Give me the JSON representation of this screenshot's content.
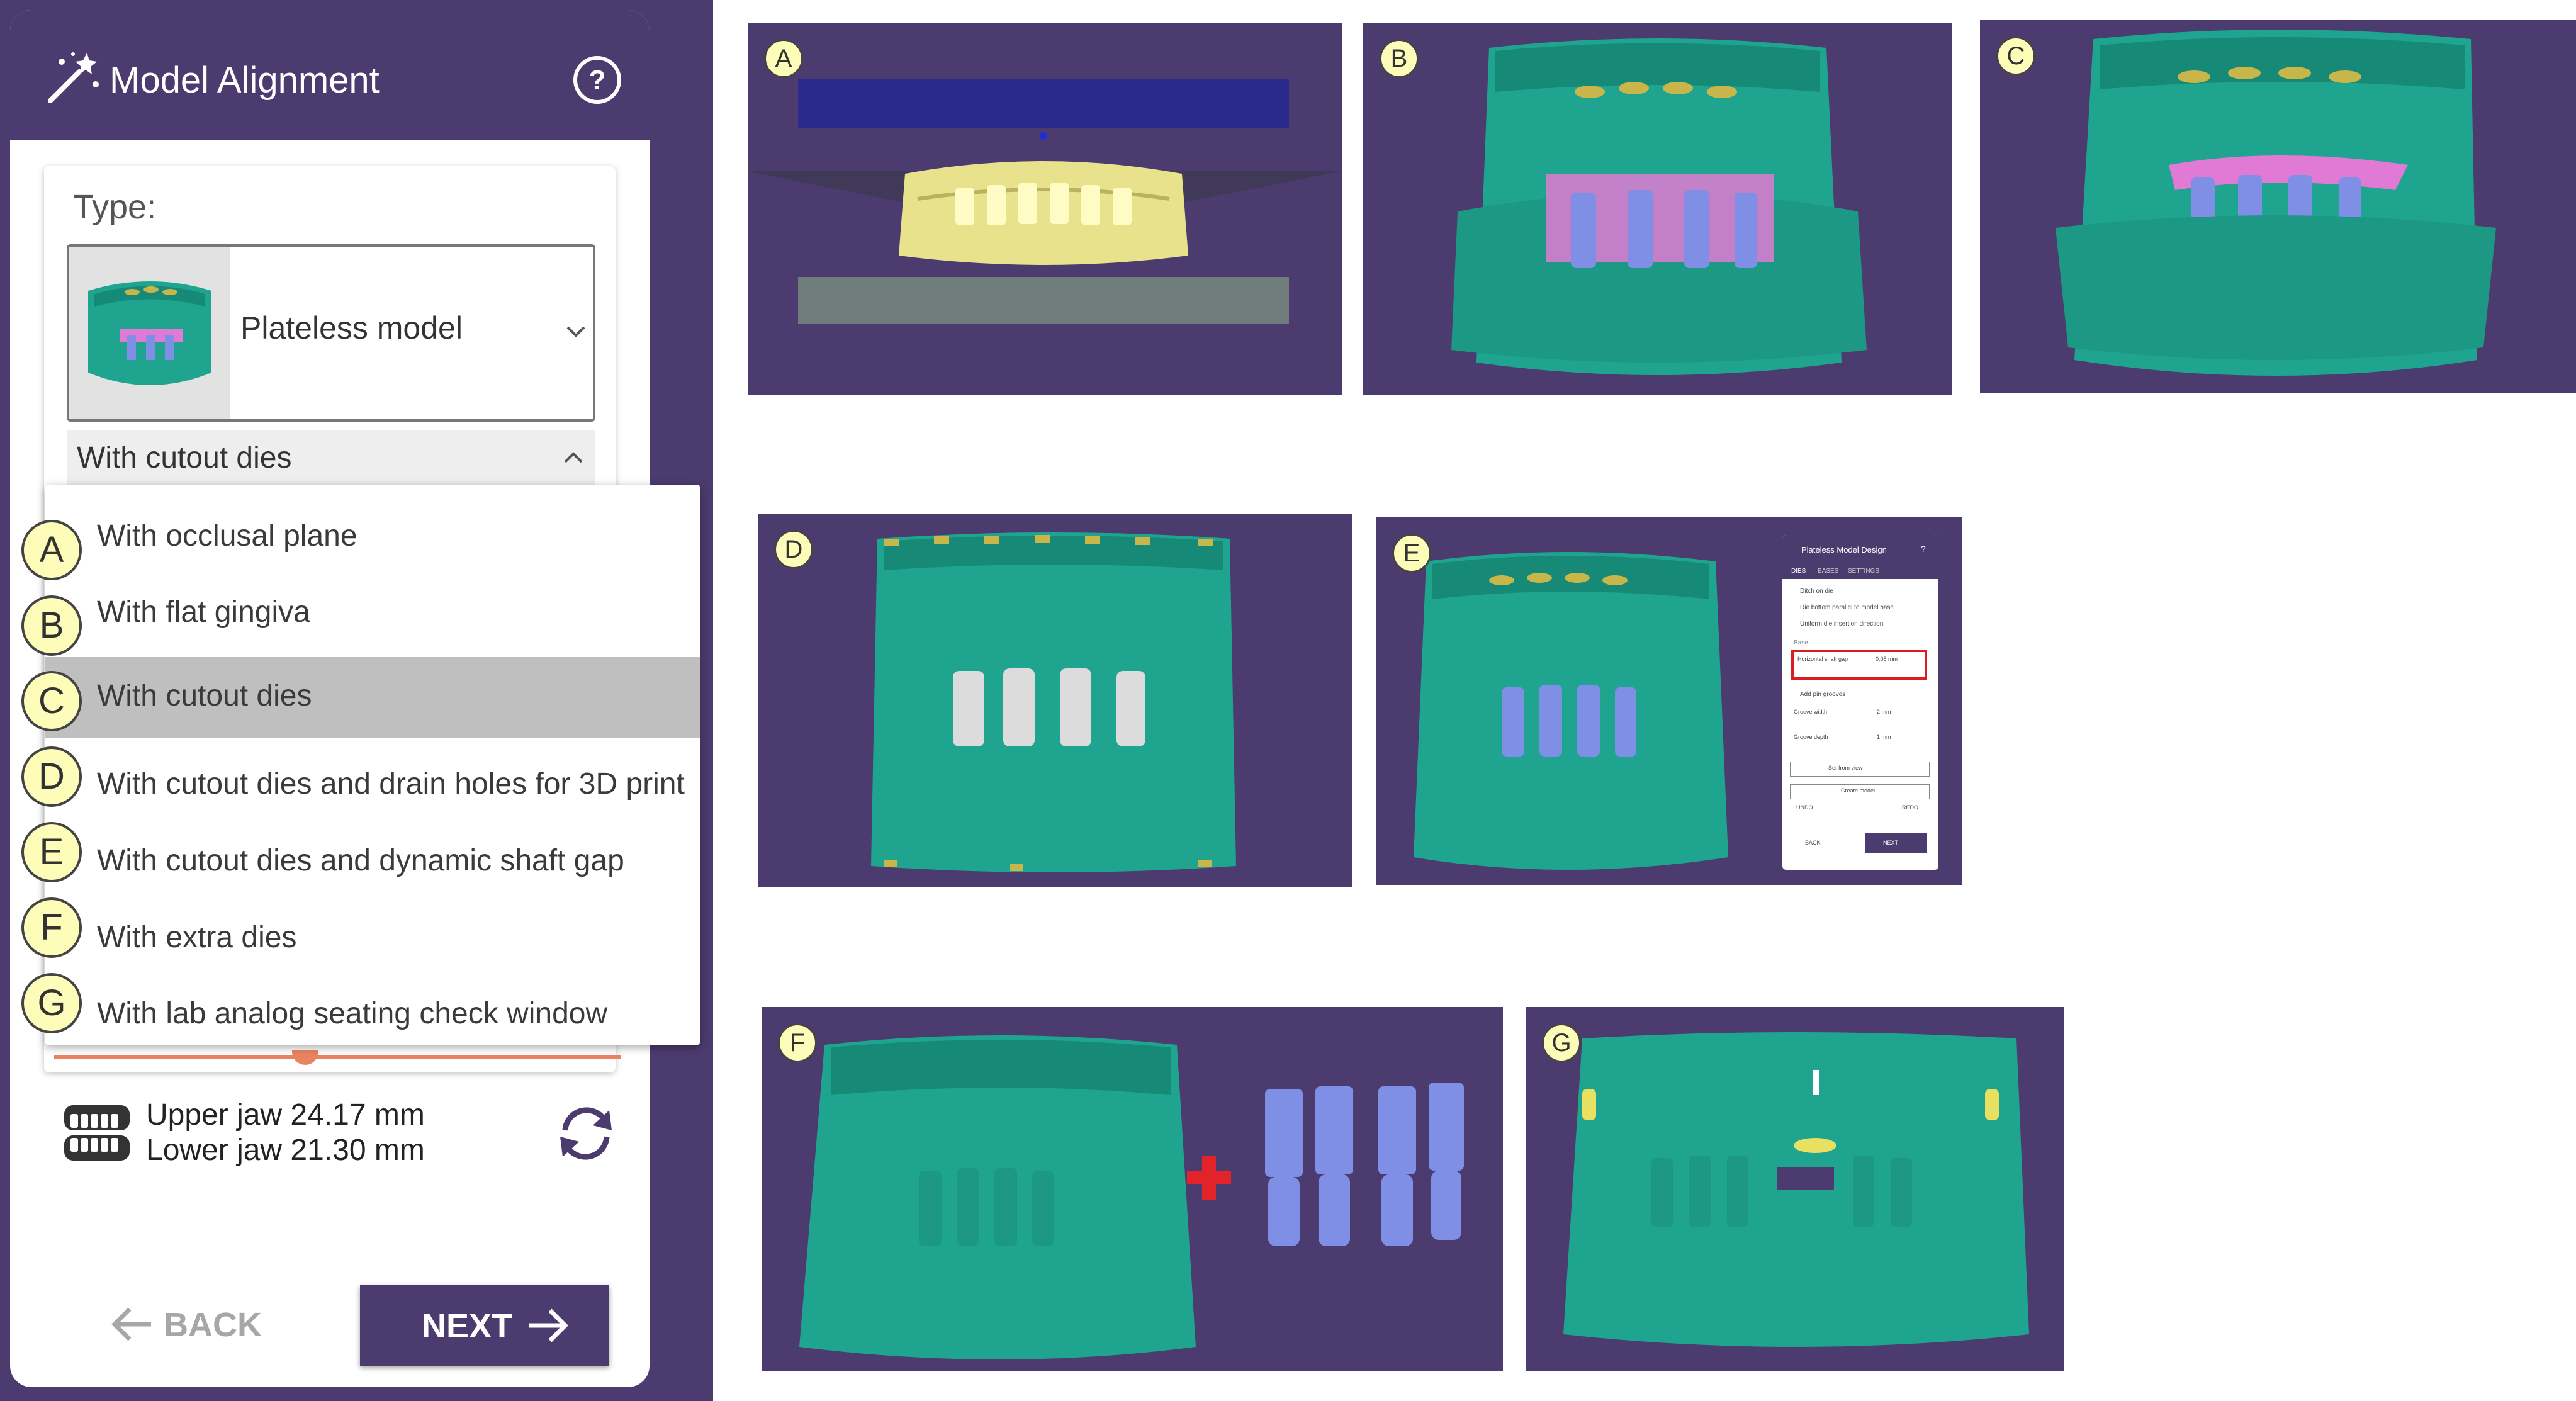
{
  "panel": {
    "title": "Model Alignment",
    "type_label": "Type:",
    "model_selected": "Plateless model",
    "variant_selected": "With cutout dies",
    "options": [
      {
        "badge": "A",
        "label": "With occlusal plane",
        "selected": false
      },
      {
        "badge": "B",
        "label": "With flat gingiva",
        "selected": false
      },
      {
        "badge": "C",
        "label": "With cutout dies",
        "selected": true
      },
      {
        "badge": "D",
        "label": "With cutout dies and drain holes for 3D print",
        "selected": false
      },
      {
        "badge": "E",
        "label": "With cutout dies and dynamic shaft gap",
        "selected": false
      },
      {
        "badge": "F",
        "label": "With extra dies",
        "selected": false
      },
      {
        "badge": "G",
        "label": "With lab analog seating check window",
        "selected": false
      }
    ],
    "upper_jaw": "Upper jaw 24.17 mm",
    "lower_jaw": "Lower jaw 21.30 mm",
    "back_label": "BACK",
    "next_label": "NEXT"
  },
  "previews": {
    "a": "A",
    "b": "B",
    "c": "C",
    "d": "D",
    "e": "E",
    "f": "F",
    "g": "G"
  },
  "mini_dialog": {
    "title": "Plateless Model Design",
    "tabs": [
      "DIES",
      "BASES",
      "SETTINGS"
    ],
    "checks": [
      "Ditch on die",
      "Die bottom parallel to model base",
      "Uniform die insertion direction"
    ],
    "base_label": "Base",
    "shaft_gap_label": "Horizontal shaft gap",
    "shaft_gap_value": "0.08 mm",
    "pin_grooves": "Add pin grooves",
    "groove_width": "Groove width",
    "groove_width_value": "2 mm",
    "groove_depth": "Groove depth",
    "groove_depth_value": "1 mm",
    "set_view": "Set from view",
    "create_model": "Create model",
    "undo": "UNDO",
    "redo": "REDO",
    "back": "BACK",
    "next": "NEXT"
  },
  "colors": {
    "purple": "#4b3b6e",
    "model_green": "#1fa58f",
    "die_blue": "#7f8fe6",
    "gingiva_pink": "#e07ad4",
    "badge_yellow": "#fdfcb9",
    "plus_red": "#e2232a"
  }
}
